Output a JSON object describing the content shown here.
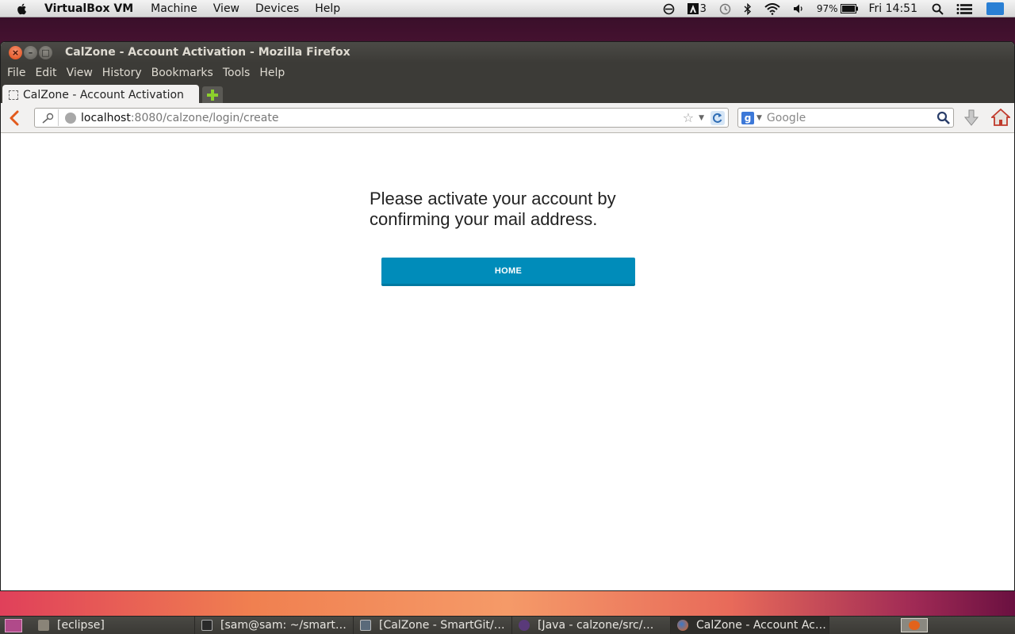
{
  "mac_menubar": {
    "app_name": "VirtualBox VM",
    "menus": [
      "Machine",
      "View",
      "Devices",
      "Help"
    ],
    "status": {
      "adobe_count": "3",
      "battery": "97%",
      "clock": "Fri 14:51"
    }
  },
  "window": {
    "title": "CalZone - Account Activation - Mozilla Firefox",
    "menus": [
      "File",
      "Edit",
      "View",
      "History",
      "Bookmarks",
      "Tools",
      "Help"
    ],
    "tab": {
      "label": "CalZone - Account Activation"
    },
    "url": {
      "host": "localhost",
      "path": ":8080/calzone/login/create"
    },
    "search": {
      "placeholder": "Google"
    }
  },
  "page": {
    "message": "Please activate your account by confirming your mail address.",
    "home_button": "HOME"
  },
  "taskbar": {
    "items": [
      "[eclipse]",
      "[sam@sam: ~/smart…",
      "[CalZone - SmartGit/…",
      "[Java - calzone/src/…",
      "CalZone - Account Ac…"
    ]
  },
  "colors": {
    "primary_button": "#008cba",
    "ubuntu_titlebar": "#3c3b37",
    "close_button": "#df4a16"
  }
}
